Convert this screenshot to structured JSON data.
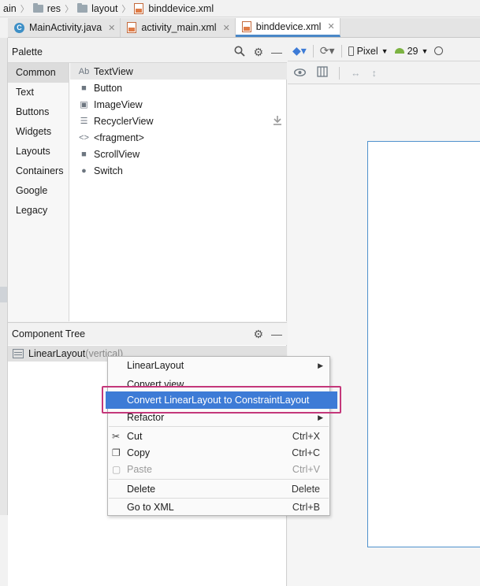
{
  "breadcrumb": [
    "ain",
    "res",
    "layout",
    "binddevice.xml"
  ],
  "tabs": [
    {
      "label": "MainActivity.java",
      "active": false
    },
    {
      "label": "activity_main.xml",
      "active": false
    },
    {
      "label": "binddevice.xml",
      "active": true
    }
  ],
  "palette": {
    "title": "Palette",
    "categories": [
      "Common",
      "Text",
      "Buttons",
      "Widgets",
      "Layouts",
      "Containers",
      "Google",
      "Legacy"
    ],
    "items": [
      {
        "icon": "Ab",
        "label": "TextView"
      },
      {
        "icon": "■",
        "label": "Button"
      },
      {
        "icon": "▣",
        "label": "ImageView"
      },
      {
        "icon": "☰",
        "label": "RecyclerView"
      },
      {
        "icon": "<>",
        "label": "<fragment>"
      },
      {
        "icon": "■",
        "label": "ScrollView"
      },
      {
        "icon": "●",
        "label": "Switch"
      }
    ]
  },
  "component_tree": {
    "title": "Component Tree",
    "root": {
      "label": "LinearLayout",
      "hint": "(vertical)"
    }
  },
  "design_toolbar": {
    "device": "Pixel",
    "api": "29"
  },
  "context_menu": {
    "items": [
      {
        "label": "LinearLayout",
        "shortcut": "",
        "submenu": true
      },
      {
        "label": "Convert view...",
        "shortcut": "",
        "submenu": false
      },
      {
        "label": "Convert LinearLayout to ConstraintLayout",
        "shortcut": "",
        "submenu": false,
        "highlighted": true
      },
      {
        "label": "Refactor",
        "shortcut": "",
        "submenu": true
      },
      {
        "label": "Cut",
        "shortcut": "Ctrl+X"
      },
      {
        "label": "Copy",
        "shortcut": "Ctrl+C"
      },
      {
        "label": "Paste",
        "shortcut": "Ctrl+V",
        "disabled": true
      },
      {
        "label": "Delete",
        "shortcut": "Delete"
      },
      {
        "label": "Go to XML",
        "shortcut": "Ctrl+B"
      }
    ]
  },
  "colors": {
    "highlight": "#3d7bd6",
    "annotation_box": "#c4377a",
    "device_outline": "#4f91cc",
    "active_tab_underline": "#4a88c7"
  }
}
